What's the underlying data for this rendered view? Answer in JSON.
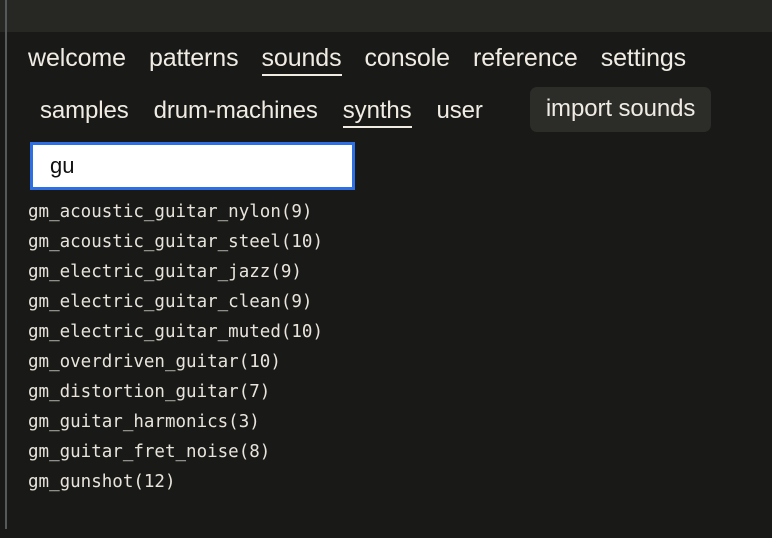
{
  "window": {
    "titlebar_color": "#272723",
    "background_color": "#191917"
  },
  "nav_primary": {
    "items": [
      {
        "label": "welcome",
        "active": false
      },
      {
        "label": "patterns",
        "active": false
      },
      {
        "label": "sounds",
        "active": true
      },
      {
        "label": "console",
        "active": false
      },
      {
        "label": "reference",
        "active": false
      },
      {
        "label": "settings",
        "active": false
      }
    ]
  },
  "nav_secondary": {
    "items": [
      {
        "label": "samples",
        "active": false
      },
      {
        "label": "drum-machines",
        "active": false
      },
      {
        "label": "synths",
        "active": true
      },
      {
        "label": "user",
        "active": false
      }
    ],
    "import_button_label": "import sounds"
  },
  "search": {
    "value": "gu",
    "placeholder": "",
    "border_color": "#2f6fe4"
  },
  "results": {
    "items": [
      "gm_acoustic_guitar_nylon(9)",
      "gm_acoustic_guitar_steel(10)",
      "gm_electric_guitar_jazz(9)",
      "gm_electric_guitar_clean(9)",
      "gm_electric_guitar_muted(10)",
      "gm_overdriven_guitar(10)",
      "gm_distortion_guitar(7)",
      "gm_guitar_harmonics(3)",
      "gm_guitar_fret_noise(8)",
      "gm_gunshot(12)"
    ]
  }
}
